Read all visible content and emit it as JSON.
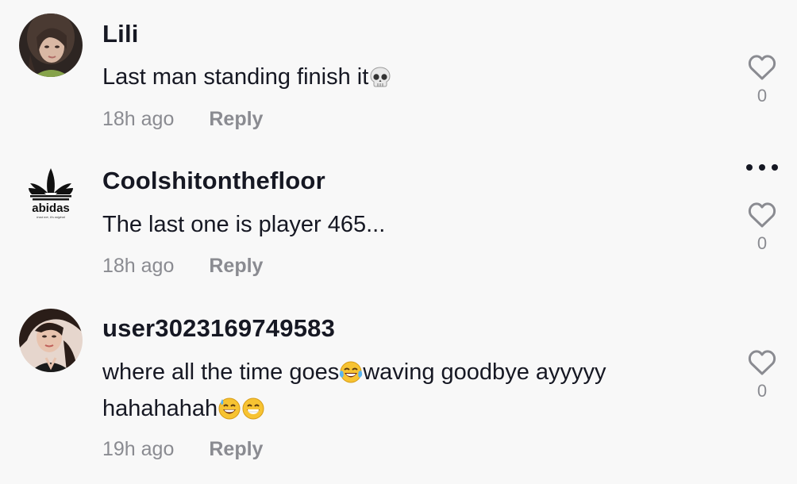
{
  "comments": [
    {
      "username": "Lili",
      "text": "Last man standing finish it",
      "emoji_after": [
        "skull"
      ],
      "time": "18h ago",
      "reply_label": "Reply",
      "likes": "0"
    },
    {
      "username": "Coolshitonthefloor",
      "avatar_logo_text": "abidas",
      "avatar_logo_tagline": "trust me, it's original",
      "text": "The last one is player 465...",
      "time": "18h ago",
      "reply_label": "Reply",
      "likes": "0"
    },
    {
      "username": "user3023169749583",
      "text_part1": "where all the time goes",
      "text_part2": "waving goodbye ayyyyy hahahahah",
      "emoji_inline": [
        "face-with-tears-of-joy"
      ],
      "emoji_after": [
        "grinning-face-with-sweat",
        "beaming-face"
      ],
      "time": "19h ago",
      "reply_label": "Reply",
      "likes": "0"
    }
  ],
  "icons": {
    "like": "heart-outline-icon",
    "more": "more-dots-icon"
  },
  "colors": {
    "background": "#f8f8f8",
    "text": "#161823",
    "secondary": "#8a8b91"
  }
}
